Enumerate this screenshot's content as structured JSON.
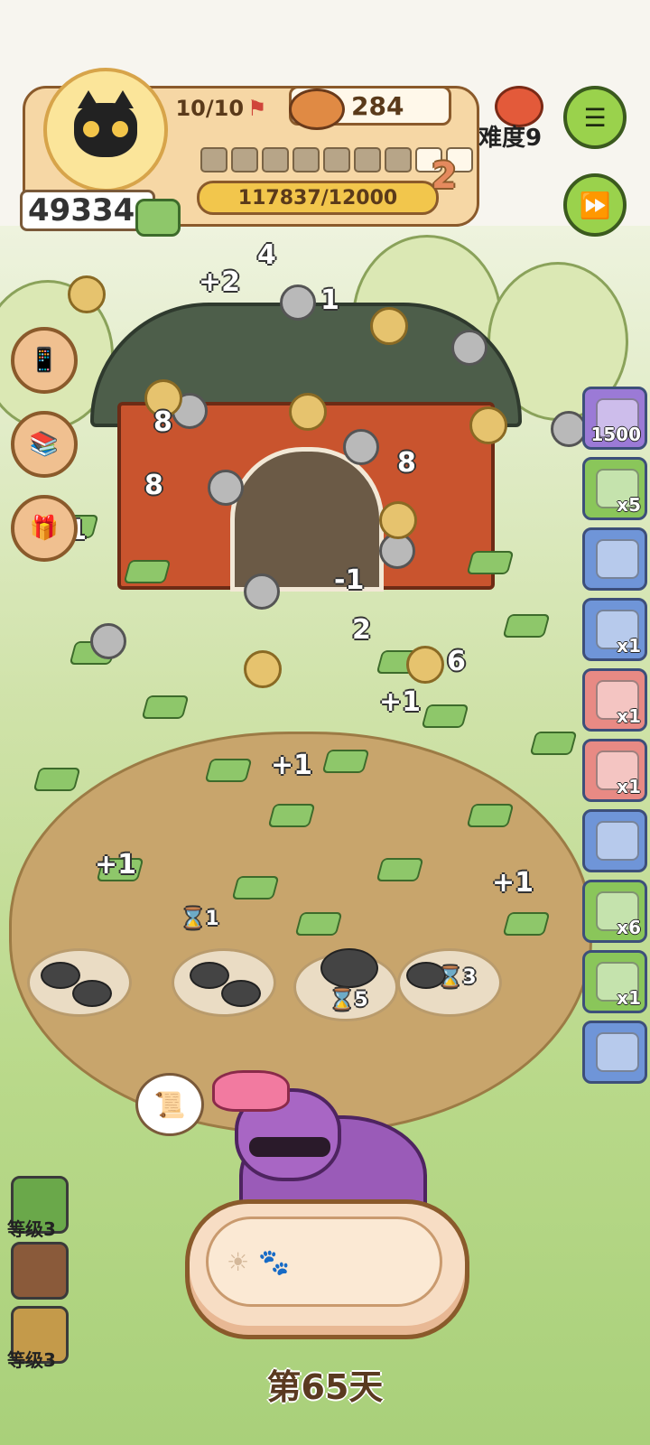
{
  "hud": {
    "cat_capacity": "10/10",
    "food_count": "284",
    "coins": "49334",
    "xp": "117837/12000",
    "level": "2",
    "progress_filled": 7,
    "progress_total": 9,
    "difficulty": "难度9"
  },
  "side_items": [
    {
      "badge": "1500",
      "color": "#9b7ad6"
    },
    {
      "badge": "x5",
      "color": "#8ac65a"
    },
    {
      "badge": "",
      "color": "#6f95d8"
    },
    {
      "badge": "x1",
      "color": "#6f95d8"
    },
    {
      "badge": "x1",
      "color": "#e88a84"
    },
    {
      "badge": "x1",
      "color": "#e88a84"
    },
    {
      "badge": "",
      "color": "#6f95d8"
    },
    {
      "badge": "x6",
      "color": "#8ac65a"
    },
    {
      "badge": "x1",
      "color": "#8ac65a"
    },
    {
      "badge": "",
      "color": "#6f95d8"
    }
  ],
  "skills": [
    {
      "label": "等级3",
      "color": "#6aa84a"
    },
    {
      "label": "",
      "color": "#8a5a3a"
    },
    {
      "label": "等级3",
      "color": "#c49a4a"
    }
  ],
  "timers": [
    "5",
    "3",
    "1"
  ],
  "floating": [
    "+1",
    "8",
    "1",
    "4",
    "+2",
    "6",
    "2",
    "-1"
  ],
  "day": "第65天",
  "icons": {
    "flag": "flag-icon",
    "bowl": "food-bowl-icon",
    "menu": "menu-icon",
    "fast_forward": "fast-forward-icon"
  }
}
